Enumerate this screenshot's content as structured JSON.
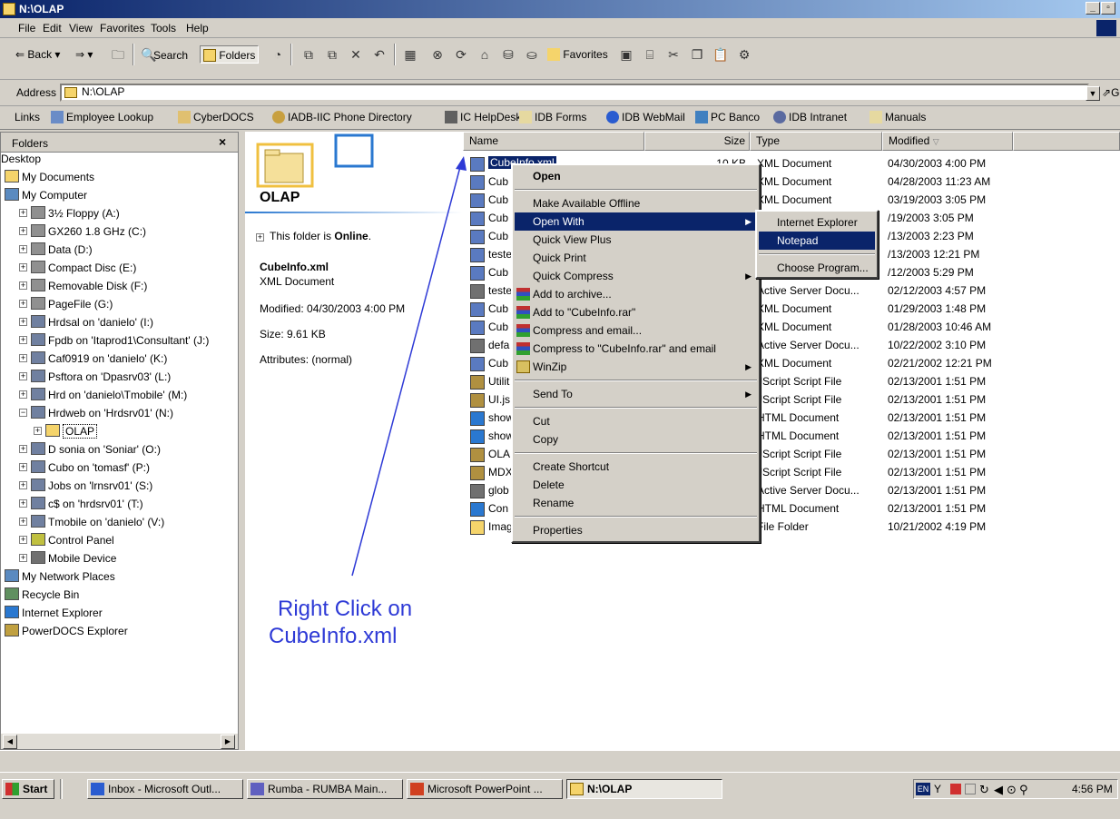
{
  "window": {
    "title": "N:\\OLAP"
  },
  "menu": [
    "File",
    "Edit",
    "View",
    "Favorites",
    "Tools",
    "Help"
  ],
  "toolbar": {
    "back": "Back",
    "search": "Search",
    "folders": "Folders",
    "favorites": "Favorites"
  },
  "address": {
    "label": "Address",
    "value": "N:\\OLAP",
    "go": "Go"
  },
  "links": {
    "label": "Links",
    "items": [
      "Employee Lookup",
      "CyberDOCS",
      "IADB-IIC Phone Directory",
      "IC HelpDesk",
      "IDB Forms",
      "IDB WebMail",
      "PC Banco",
      "IDB Intranet",
      "Manuals"
    ]
  },
  "folders": {
    "title": "Folders",
    "tree": [
      "Desktop",
      "My Documents",
      "My Computer",
      "3½ Floppy (A:)",
      "GX260 1.8 GHz (C:)",
      "Data (D:)",
      "Compact Disc (E:)",
      "Removable Disk (F:)",
      "PageFile (G:)",
      "Hrdsal on 'danielo' (I:)",
      "Fpdb on 'Itaprod1\\Consultant' (J:)",
      "Caf0919 on 'danielo' (K:)",
      "Psftora on 'Dpasrv03' (L:)",
      "Hrd on 'danielo\\Tmobile' (M:)",
      "Hrdweb on 'Hrdsrv01' (N:)",
      "OLAP",
      "D sonia on 'Soniar' (O:)",
      "Cubo on 'tomasf' (P:)",
      "Jobs on 'lrnsrv01' (S:)",
      "c$ on 'hrdsrv01' (T:)",
      "Tmobile on 'danielo' (V:)",
      "Control Panel",
      "Mobile Device",
      "My Network Places",
      "Recycle Bin",
      "Internet Explorer",
      "PowerDOCS Explorer"
    ]
  },
  "info": {
    "folder_name": "OLAP",
    "online_prefix": "This folder is ",
    "online_word": "Online",
    "online_suffix": ".",
    "file_name": "CubeInfo.xml",
    "file_type": "XML Document",
    "modified": "Modified: 04/30/2003 4:00 PM",
    "size": "Size: 9.61 KB",
    "attributes": "Attributes: (normal)"
  },
  "columns": {
    "name": "Name",
    "size": "Size",
    "type": "Type",
    "modified": "Modified"
  },
  "files": [
    {
      "name": "CubeInfo.xml",
      "size": "10 KB",
      "type": "XML Document",
      "modified": "04/30/2003 4:00 PM"
    },
    {
      "name": "Cub",
      "size": "",
      "type": "XML Document",
      "modified": "04/28/2003 11:23 AM"
    },
    {
      "name": "Cub",
      "size": "",
      "type": "XML Document",
      "modified": "03/19/2003 3:05 PM"
    },
    {
      "name": "Cub",
      "size": "",
      "type": "",
      "modified": "/19/2003 3:05 PM"
    },
    {
      "name": "Cub",
      "size": "",
      "type": "",
      "modified": "/13/2003 2:23 PM"
    },
    {
      "name": "teste",
      "size": "",
      "type": "",
      "modified": "/13/2003 12:21 PM"
    },
    {
      "name": "Cub",
      "size": "",
      "type": "",
      "modified": "/12/2003 5:29 PM"
    },
    {
      "name": "teste",
      "size": "",
      "type": "Active Server Docu...",
      "modified": "02/12/2003 4:57 PM"
    },
    {
      "name": "Cub",
      "size": "",
      "type": "XML Document",
      "modified": "01/29/2003 1:48 PM"
    },
    {
      "name": "Cub",
      "size": "",
      "type": "XML Document",
      "modified": "01/28/2003 10:46 AM"
    },
    {
      "name": "defa",
      "size": "",
      "type": "Active Server Docu...",
      "modified": "10/22/2002 3:10 PM"
    },
    {
      "name": "Cub",
      "size": "",
      "type": "XML Document",
      "modified": "02/21/2002 12:21 PM"
    },
    {
      "name": "Utilit",
      "size": "",
      "type": "JScript Script File",
      "modified": "02/13/2001 1:51 PM"
    },
    {
      "name": "UI.js",
      "size": "",
      "type": "JScript Script File",
      "modified": "02/13/2001 1:51 PM"
    },
    {
      "name": "show",
      "size": "",
      "type": "HTML Document",
      "modified": "02/13/2001 1:51 PM"
    },
    {
      "name": "show",
      "size": "",
      "type": "HTML Document",
      "modified": "02/13/2001 1:51 PM"
    },
    {
      "name": "OLA",
      "size": "",
      "type": "JScript Script File",
      "modified": "02/13/2001 1:51 PM"
    },
    {
      "name": "MDX",
      "size": "",
      "type": "JScript Script File",
      "modified": "02/13/2001 1:51 PM"
    },
    {
      "name": "glob",
      "size": "",
      "type": "Active Server Docu...",
      "modified": "02/13/2001 1:51 PM"
    },
    {
      "name": "Con",
      "size": "",
      "type": "HTML Document",
      "modified": "02/13/2001 1:51 PM"
    },
    {
      "name": "Imag",
      "size": "",
      "type": "File Folder",
      "modified": "10/21/2002 4:19 PM"
    }
  ],
  "context_menu": {
    "open": "Open",
    "offline": "Make Available Offline",
    "open_with": "Open With",
    "quick_view": "Quick View Plus",
    "quick_print": "Quick Print",
    "quick_compress": "Quick Compress",
    "add_archive": "Add to archive...",
    "add_rar": "Add to \"CubeInfo.rar\"",
    "compress_email": "Compress and email...",
    "compress_rar_email": "Compress to \"CubeInfo.rar\" and email",
    "winzip": "WinZip",
    "send_to": "Send To",
    "cut": "Cut",
    "copy": "Copy",
    "create_shortcut": "Create Shortcut",
    "delete": "Delete",
    "rename": "Rename",
    "properties": "Properties"
  },
  "open_with_menu": {
    "ie": "Internet Explorer",
    "notepad": "Notepad",
    "choose": "Choose Program..."
  },
  "annotation": {
    "line1": "Right Click on",
    "line2": "CubeInfo.xml"
  },
  "taskbar": {
    "start": "Start",
    "tasks": [
      "Inbox - Microsoft Outl...",
      "Rumba - RUMBA Main...",
      "Microsoft PowerPoint ...",
      "N:\\OLAP"
    ],
    "clock": "4:56 PM",
    "lang": "EN"
  },
  "colors": {
    "selection": "#0a246a",
    "annotation": "#2e3ad6",
    "desktop_gray": "#d4d0c8"
  }
}
